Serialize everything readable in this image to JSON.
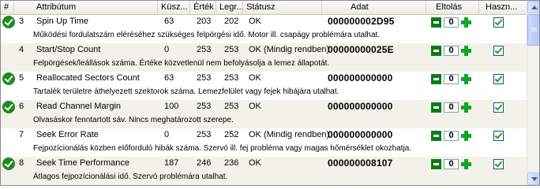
{
  "columns": {
    "num": "#",
    "attribute": "Attribútum",
    "threshold": "Küsz...",
    "value": "Érték",
    "worst": "Legr...",
    "status": "Státusz",
    "raw": "Adat",
    "offset": "Eltolás",
    "use": "Haszn..."
  },
  "rows": [
    {
      "ok": true,
      "num": "3",
      "name": "Spin Up Time",
      "threshold": "63",
      "value": "203",
      "worst": "202",
      "status": "OK",
      "raw": "000000002D95",
      "offset": "0",
      "used": true,
      "desc": "Működési fordulatszám eléréséhez szükséges felpörgési idő. Motor ill. csapágy problémára utalhat."
    },
    {
      "ok": false,
      "num": "4",
      "name": "Start/Stop Count",
      "threshold": "0",
      "value": "253",
      "worst": "253",
      "status": "OK (Mindig rendben)",
      "raw": "00000000025E",
      "offset": "0",
      "used": true,
      "desc": "Felpörgések/leállások száma. Értéke közvetlenül nem befolyásolja a lemez állapotát."
    },
    {
      "ok": true,
      "num": "5",
      "name": "Reallocated Sectors Count",
      "threshold": "63",
      "value": "253",
      "worst": "253",
      "status": "OK",
      "raw": "000000000000",
      "offset": "0",
      "used": true,
      "desc": "Tartalék területre áthelyezett szektorok száma. Lemezfelület vagy fejek hibájára utalhat."
    },
    {
      "ok": true,
      "num": "6",
      "name": "Read Channel Margin",
      "threshold": "100",
      "value": "253",
      "worst": "253",
      "status": "OK",
      "raw": "000000000000",
      "offset": "0",
      "used": true,
      "desc": "Olvasáskor fenntartott sáv. Nincs meghatározott szerepe."
    },
    {
      "ok": false,
      "num": "7",
      "name": "Seek Error Rate",
      "threshold": "0",
      "value": "253",
      "worst": "252",
      "status": "OK (Mindig rendben)",
      "raw": "000000000000",
      "offset": "0",
      "used": true,
      "desc": "Fejpozícionálás közben előforduló hibák száma. Szervó ill. fej probléma vagy magas hőmérséklet okozhatja."
    },
    {
      "ok": true,
      "num": "8",
      "name": "Seek Time Performance",
      "threshold": "187",
      "value": "246",
      "worst": "236",
      "status": "OK",
      "raw": "000000008107",
      "offset": "0",
      "used": true,
      "desc": "Átlagos fejpozícionálási idő. Szervó problémára utalhat."
    }
  ]
}
